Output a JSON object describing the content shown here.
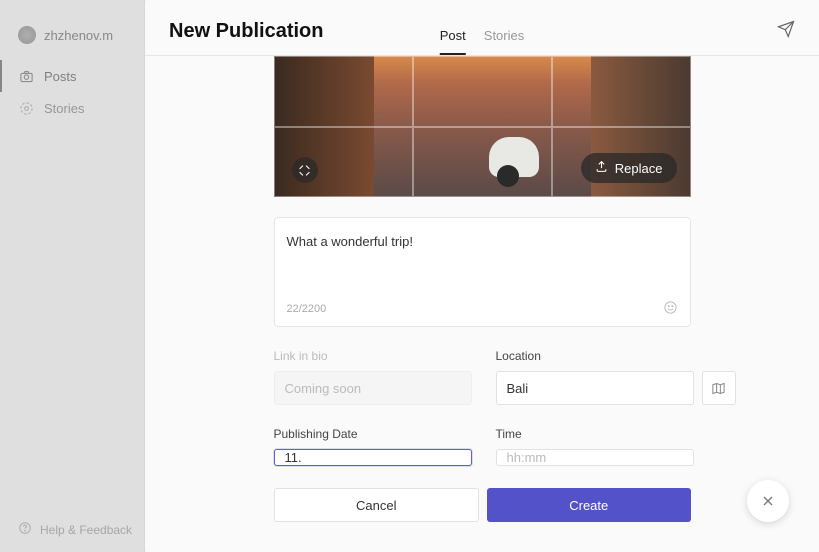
{
  "sidebar": {
    "username": "zhzhenov.m",
    "nav": [
      {
        "label": "Posts",
        "icon": "camera-icon"
      },
      {
        "label": "Stories",
        "icon": "stories-icon"
      }
    ],
    "help_label": "Help & Feedback"
  },
  "modal": {
    "title": "New Publication",
    "tabs": [
      "Post",
      "Stories"
    ],
    "active_tab": "Post",
    "replace_label": "Replace",
    "caption_value": "What a wonderful trip!",
    "caption_counter": "22/2200",
    "link_in_bio": {
      "label": "Link in bio",
      "placeholder": "Coming soon"
    },
    "location": {
      "label": "Location",
      "value": "Bali"
    },
    "publishing_date": {
      "label": "Publishing Date",
      "value": "11."
    },
    "time": {
      "label": "Time",
      "placeholder": "hh:mm"
    },
    "buttons": {
      "cancel": "Cancel",
      "create": "Create"
    }
  }
}
